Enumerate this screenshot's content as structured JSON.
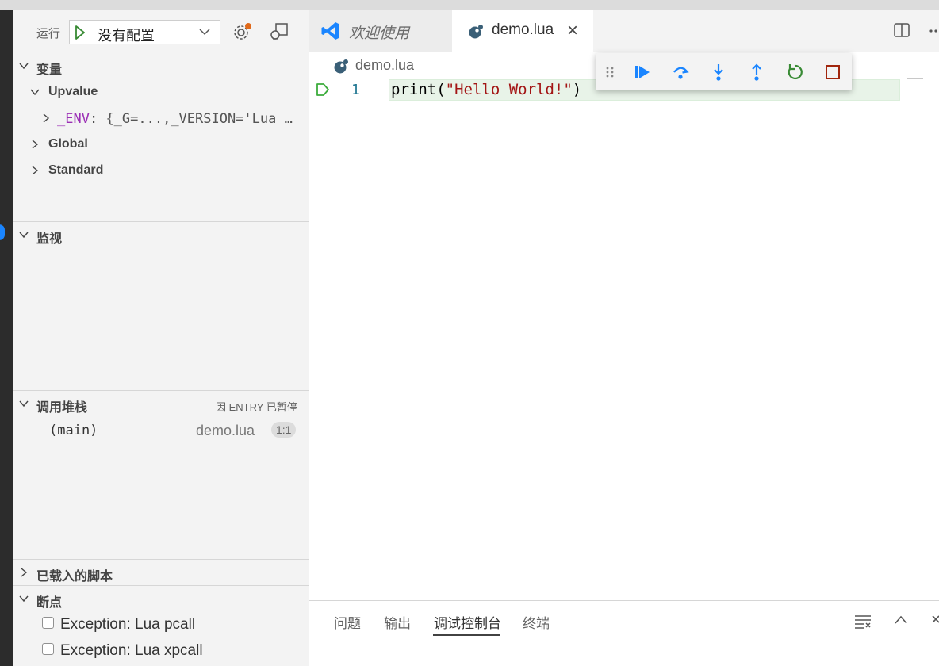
{
  "debug_sidebar": {
    "run_label": "运行",
    "config_value": "没有配置",
    "icons": [
      "run-play-icon",
      "chevron-down-icon",
      "gear-icon",
      "debug-console-icon"
    ]
  },
  "variables": {
    "header": "变量",
    "upvalue": "Upvalue",
    "env_name": "_ENV",
    "env_value": " {_G=...,_VERSION='Lua …",
    "global": "Global",
    "standard": "Standard"
  },
  "watch": {
    "header": "监视"
  },
  "call_stack": {
    "header": "调用堆栈",
    "status": "因 ENTRY 已暂停",
    "frames": [
      {
        "name": "(main)",
        "file": "demo.lua",
        "position": "1:1"
      }
    ]
  },
  "loaded_scripts": {
    "header": "已载入的脚本"
  },
  "breakpoints": {
    "header": "断点",
    "items": [
      {
        "label": "Exception: Lua pcall",
        "checked": false
      },
      {
        "label": "Exception: Lua xpcall",
        "checked": false
      }
    ]
  },
  "tabs": [
    {
      "label": "欢迎使用",
      "icon": "vscode-logo-icon"
    },
    {
      "label": "demo.lua",
      "icon": "lua-file-icon",
      "close": "×"
    }
  ],
  "editor": {
    "breadcrumb": "demo.lua",
    "line_number": "1",
    "code": {
      "fn": "print(",
      "str": "\"Hello World!\"",
      "close": ")"
    }
  },
  "debug_toolbar": [
    "drag-handle-icon",
    "continue-icon",
    "step-over-icon",
    "step-into-icon",
    "step-out-icon",
    "restart-icon",
    "stop-icon"
  ],
  "panel": {
    "tabs": [
      "问题",
      "输出",
      "调试控制台",
      "终端"
    ],
    "active_tab": "调试控制台"
  },
  "colors": {
    "accent_blue": "#1a85ff",
    "debug_blue": "#1a85ff",
    "restart_green": "#388a34",
    "stop_red": "#a1260d",
    "current_line": "#e8f3e8",
    "string": "#a31515",
    "line_number": "#237893"
  }
}
